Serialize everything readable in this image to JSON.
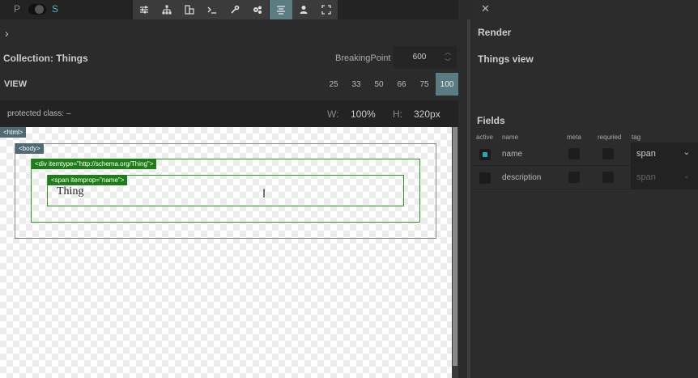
{
  "toolbar": {
    "p_label": "P",
    "s_label": "S",
    "icons": [
      "sliders-icon",
      "sitemap-icon",
      "blocks-icon",
      "terminal-icon",
      "wrench-icon",
      "cogs-icon",
      "align-icon",
      "user-icon",
      "fullscreen-icon"
    ],
    "active_icon": "align-icon"
  },
  "left": {
    "expand_glyph": "›",
    "collection_title": "Collection: Things",
    "breakpoint_label": "BreakingPoint",
    "breakpoint_value": "600",
    "view_label": "VIEW",
    "view_options": [
      "25",
      "33",
      "50",
      "66",
      "75",
      "100"
    ],
    "view_selected": "100",
    "protected_class": "protected class: –",
    "width_label": "W:",
    "width_value": "100%",
    "height_label": "H:",
    "height_value": "320px"
  },
  "canvas": {
    "html_tag": "<html>",
    "body_tag": "<body>",
    "div_tag": "<div itemtype=\"http://schema.org/Thing\">",
    "span_tag": "<span itemprop=\"name\">",
    "content_text": "Thing"
  },
  "right": {
    "close_glyph": "✕",
    "render_title": "Render",
    "view_name": "Things view",
    "fields_title": "Fields",
    "columns": [
      "active",
      "name",
      "meta",
      "requried",
      "tag"
    ],
    "fields": [
      {
        "active": true,
        "name": "name",
        "tag": "span"
      },
      {
        "active": false,
        "name": "description",
        "tag": "span"
      }
    ]
  },
  "colors": {
    "accent": "#5c7c84",
    "active_check": "#29a6b8",
    "outline_green": "#2a9a24"
  }
}
